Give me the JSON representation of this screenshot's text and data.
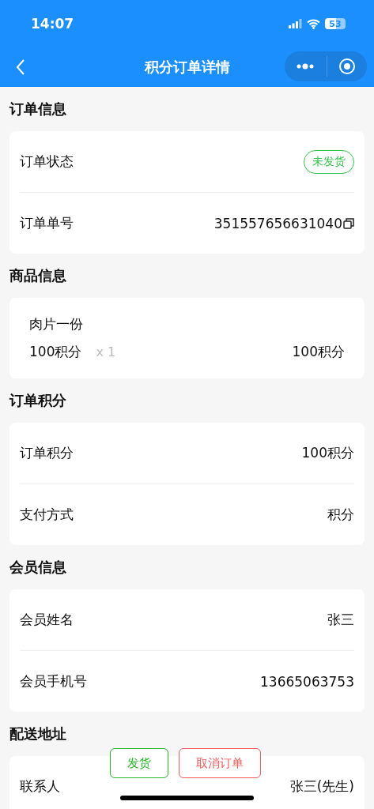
{
  "status_bar": {
    "time": "14:07",
    "battery": "53"
  },
  "nav": {
    "title": "积分订单详情"
  },
  "sections": [
    {
      "title": "订单信息",
      "kind": "rows",
      "rows": [
        {
          "label": "订单状态",
          "value": "未发货",
          "kind": "badge",
          "color": "#33c24d"
        },
        {
          "label": "订单单号",
          "value": "351557656631040",
          "kind": "copy"
        }
      ]
    },
    {
      "title": "商品信息",
      "kind": "goods",
      "goods": {
        "name": "肉片一份",
        "price": "100积分",
        "quantity": "x 1",
        "total": "100积分"
      }
    },
    {
      "title": "订单积分",
      "kind": "rows",
      "rows": [
        {
          "label": "订单积分",
          "value": "100积分",
          "kind": "text"
        },
        {
          "label": "支付方式",
          "value": "积分",
          "kind": "text"
        }
      ]
    },
    {
      "title": "会员信息",
      "kind": "rows",
      "rows": [
        {
          "label": "会员姓名",
          "value": "张三",
          "kind": "text"
        },
        {
          "label": "会员手机号",
          "value": "13665063753",
          "kind": "text"
        }
      ]
    },
    {
      "title": "配送地址",
      "kind": "rows",
      "rows": [
        {
          "label": "联系人",
          "value": "张三(先生)",
          "kind": "text"
        }
      ]
    }
  ],
  "actions": [
    {
      "label": "发货",
      "color": "#2ab52a"
    },
    {
      "label": "取消订单",
      "color": "#f05a5a"
    }
  ]
}
